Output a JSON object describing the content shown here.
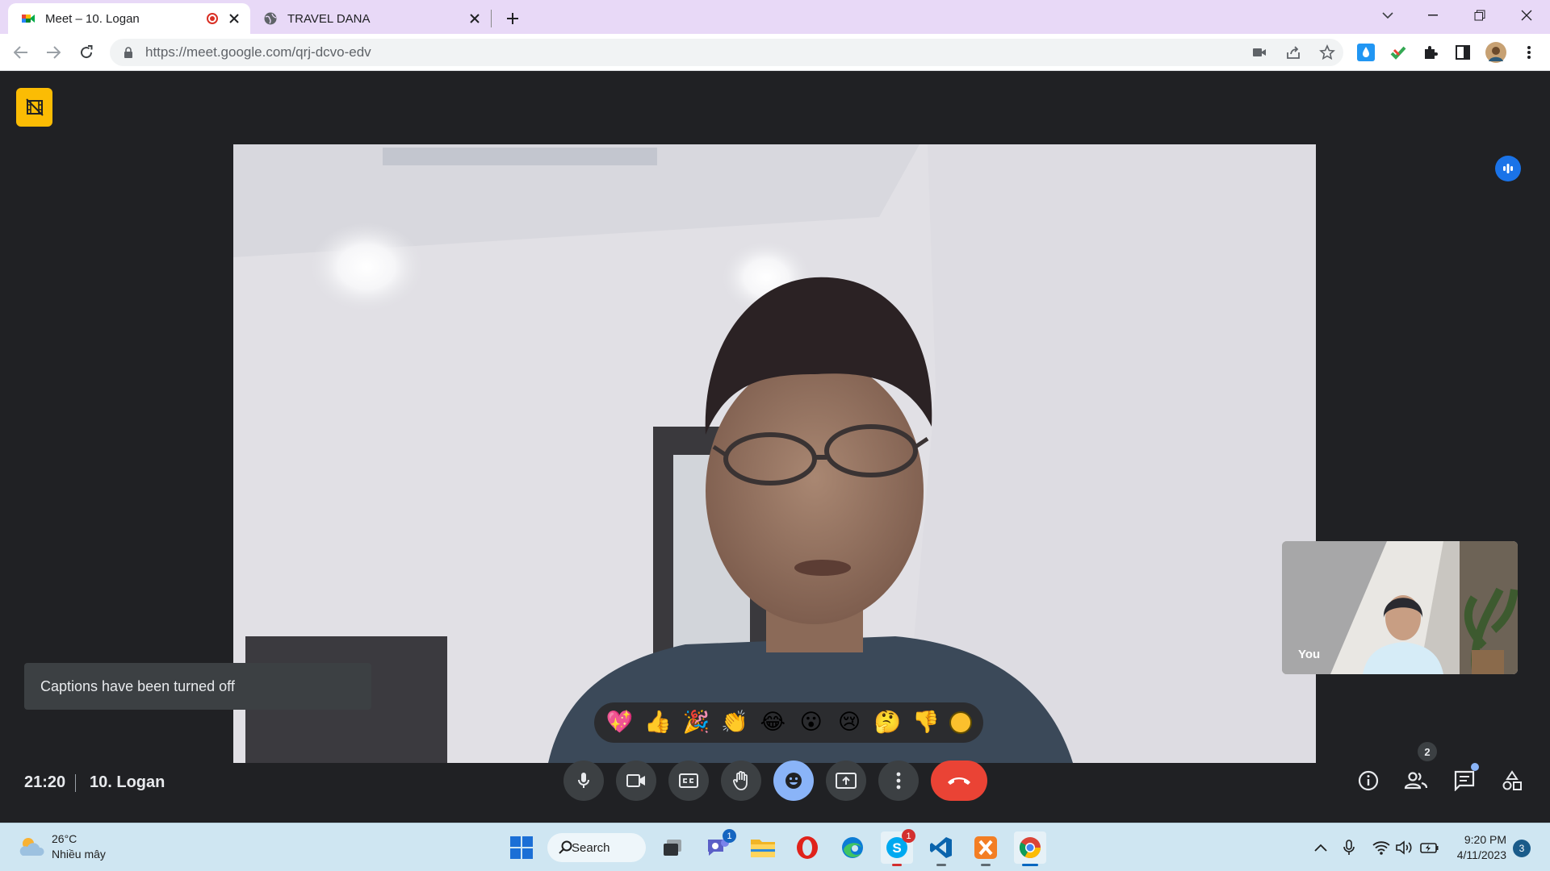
{
  "browser": {
    "tabs": [
      {
        "title": "Meet – 10. Logan",
        "icon": "google-meet-icon",
        "recording": true
      },
      {
        "title": "TRAVEL DANA",
        "icon": "globe-icon",
        "recording": false
      }
    ],
    "url": "https://meet.google.com/qrj-dcvo-edv"
  },
  "meet": {
    "self_label": "You",
    "toast": "Captions have been turned off",
    "clock": "21:20",
    "meeting_name": "10. Logan",
    "reactions": [
      "💖",
      "👍",
      "🎉",
      "👏",
      "😂",
      "😮",
      "😢",
      "🤔",
      "👎"
    ],
    "participants_count": "2",
    "controls": [
      "mic-icon",
      "camera-icon",
      "captions-icon",
      "raise-hand-icon",
      "emoji-icon",
      "present-icon",
      "more-icon",
      "end-call-icon"
    ],
    "colors": {
      "background": "#202124",
      "end_call": "#ea4335",
      "active": "#8ab4f8",
      "badge": "#fbbc04"
    }
  },
  "taskbar": {
    "weather_temp": "26°C",
    "weather_desc": "Nhiều mây",
    "search_label": "Search",
    "teams_badge": "1",
    "skype_badge": "1",
    "time": "9:20 PM",
    "date": "4/11/2023",
    "notifications": "3"
  }
}
